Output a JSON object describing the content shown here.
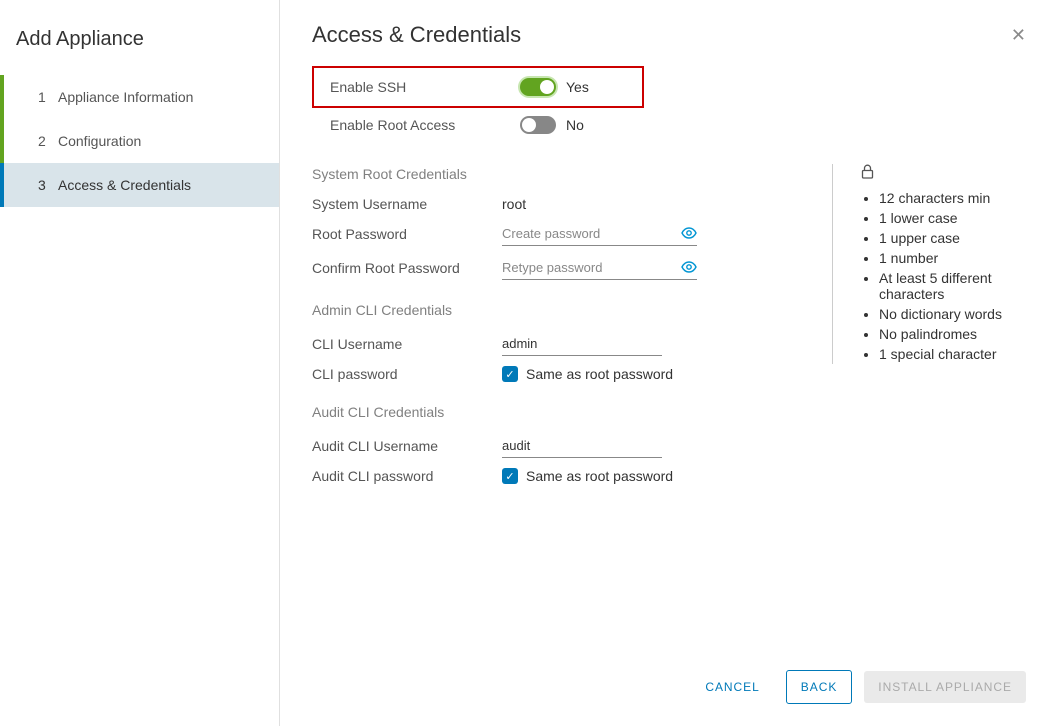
{
  "sidebar": {
    "title": "Add Appliance",
    "steps": [
      {
        "num": "1",
        "label": "Appliance Information"
      },
      {
        "num": "2",
        "label": "Configuration"
      },
      {
        "num": "3",
        "label": "Access & Credentials"
      }
    ]
  },
  "main": {
    "title": "Access & Credentials",
    "enable_ssh": {
      "label": "Enable SSH",
      "state": "Yes"
    },
    "enable_root_access": {
      "label": "Enable Root Access",
      "state": "No"
    },
    "sections": {
      "system_root": {
        "title": "System Root Credentials",
        "username_label": "System Username",
        "username_value": "root",
        "password_label": "Root Password",
        "password_placeholder": "Create password",
        "confirm_label": "Confirm Root Password",
        "confirm_placeholder": "Retype password"
      },
      "admin_cli": {
        "title": "Admin CLI Credentials",
        "username_label": "CLI Username",
        "username_value": "admin",
        "password_label": "CLI password",
        "same_as_root": "Same as root password"
      },
      "audit_cli": {
        "title": "Audit CLI Credentials",
        "username_label": "Audit CLI Username",
        "username_value": "audit",
        "password_label": "Audit CLI password",
        "same_as_root": "Same as root password"
      }
    },
    "password_rules": [
      "12 characters min",
      "1 lower case",
      "1 upper case",
      "1 number",
      "At least 5 different characters",
      "No dictionary words",
      "No palindromes",
      "1 special character"
    ]
  },
  "footer": {
    "cancel": "CANCEL",
    "back": "BACK",
    "install": "INSTALL APPLIANCE"
  }
}
